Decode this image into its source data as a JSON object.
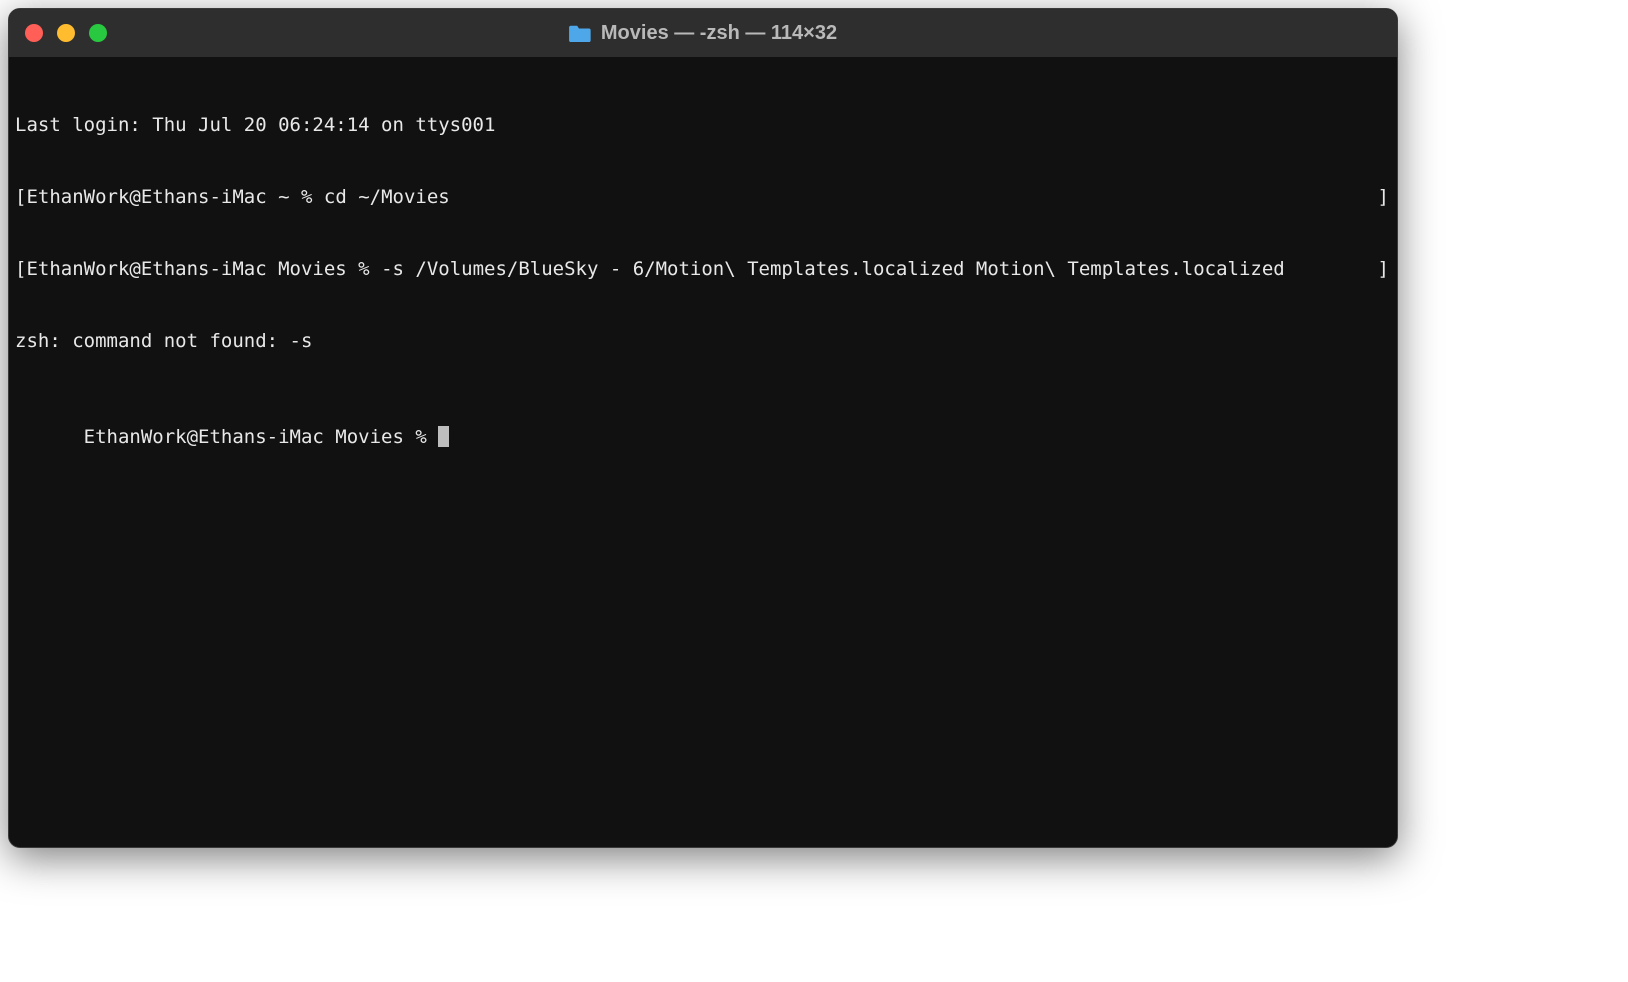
{
  "window": {
    "title": "Movies — -zsh — 114×32"
  },
  "terminal": {
    "line1": "Last login: Thu Jul 20 06:24:14 on ttys001",
    "line2_left_bracket": "[",
    "line2_prompt": "EthanWork@Ethans-iMac ~ % ",
    "line2_cmd": "cd ~/Movies",
    "line2_right_bracket": "]",
    "line3_left_bracket": "[",
    "line3_prompt": "EthanWork@Ethans-iMac Movies % ",
    "line3_cmd": "-s /Volumes/BlueSky - 6/Motion\\ Templates.localized Motion\\ Templates.localized",
    "line3_right_bracket": "]",
    "line4": "zsh: command not found: -s",
    "line5_prompt": "EthanWork@Ethans-iMac Movies % "
  }
}
